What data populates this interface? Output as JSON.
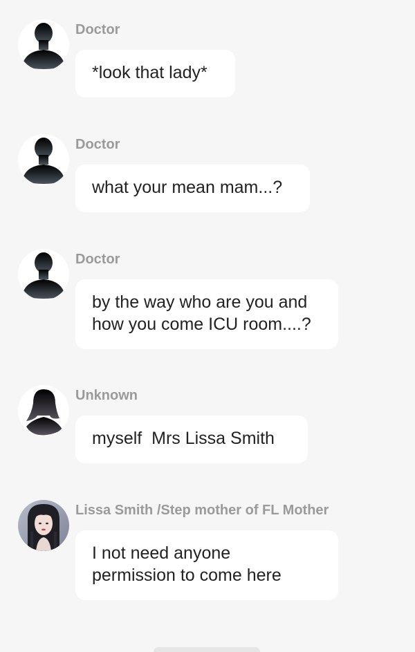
{
  "messages": [
    {
      "sender": "Doctor",
      "text": "*look that lady*",
      "avatar": "silhouette-male-icon"
    },
    {
      "sender": "Doctor",
      "text": "what your mean mam...?",
      "avatar": "silhouette-male-icon"
    },
    {
      "sender": "Doctor",
      "text": "by the way who are you and\nhow you come ICU room....?",
      "avatar": "silhouette-male-icon"
    },
    {
      "sender": "Unknown",
      "text": "myself  Mrs Lissa Smith",
      "avatar": "silhouette-female-icon"
    },
    {
      "sender": "Lissa Smith /Step mother of FL Mother",
      "text": "I not need anyone\npermission to come here",
      "avatar": "lissa-portrait-icon"
    }
  ],
  "colors": {
    "background": "#f6f6f6",
    "bubble": "#ffffff",
    "sender_name": "#9a9a9a",
    "message_text": "#222222"
  }
}
